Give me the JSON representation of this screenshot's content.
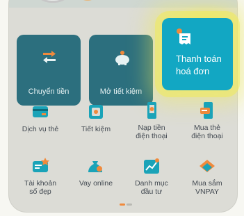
{
  "main_actions": [
    {
      "label": "Chuyển tiền",
      "icon": "transfer-icon"
    },
    {
      "label": "Mở tiết kiệm",
      "icon": "piggy-bank-icon"
    },
    {
      "label_line1": "Thanh toán",
      "label_line2": "hoá đơn",
      "icon": "bill-icon"
    }
  ],
  "services": [
    {
      "label_line1": "Dịch vụ thẻ",
      "label_line2": "",
      "icon": "card-icon"
    },
    {
      "label_line1": "Tiết kiệm",
      "label_line2": "",
      "icon": "safe-icon"
    },
    {
      "label_line1": "Nạp tiền",
      "label_line2": "điện thoại",
      "icon": "phone-topup-icon"
    },
    {
      "label_line1": "Mua thẻ",
      "label_line2": "điện thoại",
      "icon": "phone-card-icon"
    },
    {
      "label_line1": "Tài khoản",
      "label_line2": "số đẹp",
      "icon": "account-number-icon"
    },
    {
      "label_line1": "Vay online",
      "label_line2": "",
      "icon": "loan-icon"
    },
    {
      "label_line1": "Danh mục",
      "label_line2": "đầu tư",
      "icon": "investment-icon"
    },
    {
      "label_line1": "Mua sắm",
      "label_line2": "VNPAY",
      "icon": "shopping-icon"
    }
  ],
  "colors": {
    "accent": "#12a7c3",
    "highlight": "#f0eb5a",
    "icon_teal": "#1aa3b8",
    "icon_orange": "#f08a3c"
  }
}
